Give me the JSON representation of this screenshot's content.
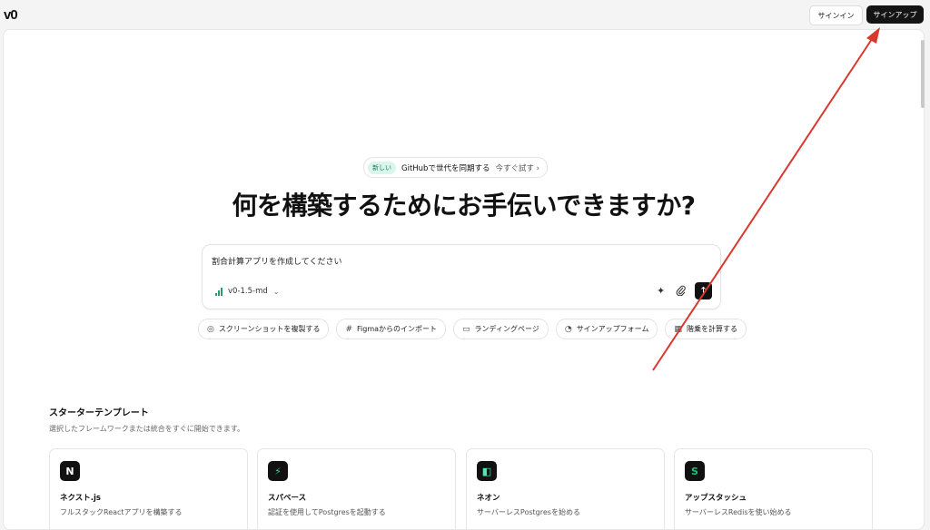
{
  "topbar": {
    "logo": "v0",
    "signin_label": "サインイン",
    "signup_label": "サインアップ"
  },
  "announcement": {
    "badge": "新しい",
    "text": "GitHubで世代を同期する",
    "cta": "今すぐ試す ›"
  },
  "headline": "何を構築するためにお手伝いできますか?",
  "prompt": {
    "value": "割合計算アプリを作成してください",
    "model": "v0-1.5-md",
    "model_chevron": "⌄",
    "send": "↑"
  },
  "chips": [
    {
      "icon": "◎",
      "label": "スクリーンショットを複製する"
    },
    {
      "icon": "#",
      "label": "Figmaからのインポート"
    },
    {
      "icon": "▭",
      "label": "ランディングページ"
    },
    {
      "icon": "◔",
      "label": "サインアップフォーム"
    },
    {
      "icon": "▦",
      "label": "階乗を計算する"
    }
  ],
  "templates": {
    "title": "スターターテンプレート",
    "subtitle": "選択したフレームワークまたは統合をすぐに開始できます。",
    "cards": [
      {
        "icon": "N",
        "icon_color": "#111111",
        "icon_fg": "#ffffff",
        "title": "ネクスト.js",
        "desc": "フルスタックReactアプリを構築する"
      },
      {
        "icon": "⚡",
        "icon_color": "#111111",
        "icon_fg": "#3ecf8e",
        "title": "スパベース",
        "desc": "認証を使用してPostgresを起動する"
      },
      {
        "icon": "◧",
        "icon_color": "#111111",
        "icon_fg": "#4ee8b0",
        "title": "ネオン",
        "desc": "サーバーレスPostgresを始める"
      },
      {
        "icon": "S",
        "icon_color": "#111111",
        "icon_fg": "#19c37d",
        "title": "アップスタッシュ",
        "desc": "サーバーレスRedisを使い始める"
      }
    ]
  },
  "colors": {
    "annotation_arrow": "#d9382f",
    "accent": "#111111"
  }
}
